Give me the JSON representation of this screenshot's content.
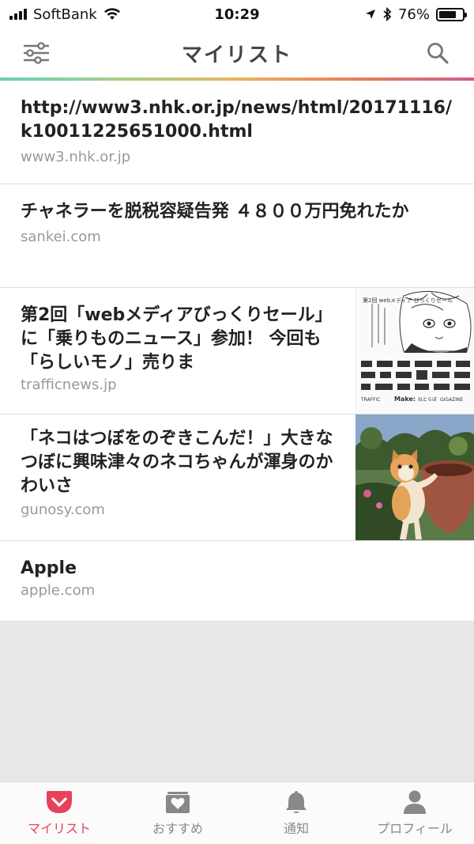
{
  "status": {
    "carrier": "SoftBank",
    "time": "10:29",
    "battery": "76%",
    "battery_level": 0.76
  },
  "header": {
    "title": "マイリスト"
  },
  "items": [
    {
      "title": "http://www3.nhk.or.jp/news/html/20171116/k10011225651000.html",
      "source": "www3.nhk.or.jp"
    },
    {
      "title": "チャネラーを脱税容疑告発 ４８００万円免れたか",
      "source": "sankei.com"
    },
    {
      "title": "第2回「webメディアびっくりセール」に「乗りものニュース」参加！ 今回も「らしいモノ」売りま",
      "source": "trafficnews.jp",
      "thumb_text": "第2回 webメディア びっくりセール",
      "thumb_logos": [
        "TRAFFIC",
        "Make:",
        "ねとらぼ",
        "GIGAZINE"
      ]
    },
    {
      "title": "「ネコはつぼをのぞきこんだ！」大きなつぼに興味津々のネコちゃんが渾身のかわいさ",
      "source": "gunosy.com"
    },
    {
      "title": "Apple",
      "source": "apple.com"
    }
  ],
  "tabs": [
    {
      "label": "マイリスト",
      "icon": "pocket-icon",
      "active": true
    },
    {
      "label": "おすすめ",
      "icon": "recommend-icon",
      "active": false
    },
    {
      "label": "通知",
      "icon": "bell-icon",
      "active": false
    },
    {
      "label": "プロフィール",
      "icon": "profile-icon",
      "active": false
    }
  ],
  "colors": {
    "accent": "#e8415a",
    "text": "#222222",
    "muted": "#999999",
    "background": "#e8e8e8"
  }
}
